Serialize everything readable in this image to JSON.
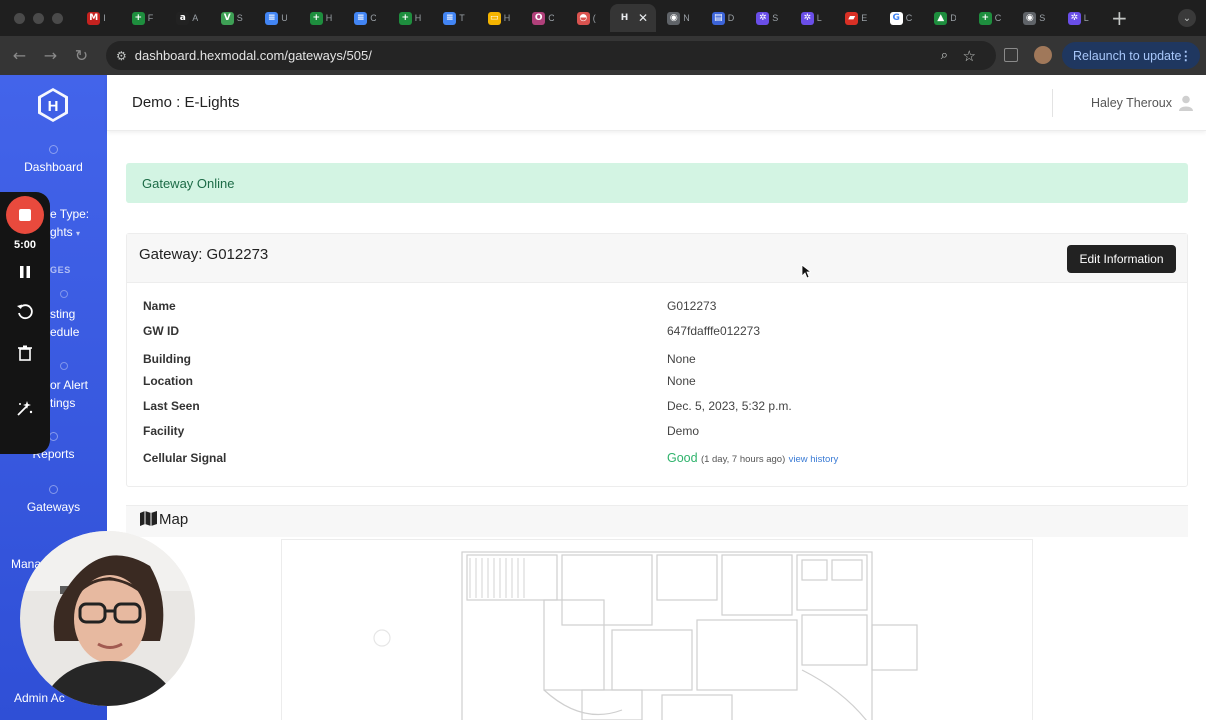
{
  "browser": {
    "tabs": [
      {
        "icon": "gmail-icon",
        "color": "#c5221f",
        "letter": "M",
        "label": "I"
      },
      {
        "icon": "sheets-icon",
        "color": "#1e8e3e",
        "letter": "+",
        "label": "F"
      },
      {
        "icon": "amazon-icon",
        "color": "#222222",
        "letter": "a",
        "label": "A"
      },
      {
        "icon": "v-brand-icon",
        "color": "#3ea055",
        "letter": "V",
        "label": "S"
      },
      {
        "icon": "docs-icon",
        "color": "#4285f4",
        "letter": "≡",
        "label": "U"
      },
      {
        "icon": "sheets-icon",
        "color": "#1e8e3e",
        "letter": "+",
        "label": "H"
      },
      {
        "icon": "docs-icon",
        "color": "#4285f4",
        "letter": "≡",
        "label": "C"
      },
      {
        "icon": "sheets-icon",
        "color": "#1e8e3e",
        "letter": "+",
        "label": "H"
      },
      {
        "icon": "docs-icon",
        "color": "#4285f4",
        "letter": "≡",
        "label": "T"
      },
      {
        "icon": "slides-icon",
        "color": "#f4b400",
        "letter": "▭",
        "label": "H"
      },
      {
        "icon": "circle-o-icon",
        "color": "#b0407a",
        "letter": "O",
        "label": "C"
      },
      {
        "icon": "cloud-icon",
        "color": "#d9534f",
        "letter": "◓",
        "label": "("
      },
      {
        "icon": "hexmodal-icon",
        "color": "#353535",
        "letter": "H",
        "label": "",
        "active": true
      },
      {
        "icon": "chrome-icon",
        "color": "#5f6368",
        "letter": "◉",
        "label": "N"
      },
      {
        "icon": "calendar-icon",
        "color": "#3c64d8",
        "letter": "▤",
        "label": "D"
      },
      {
        "icon": "gear-icon",
        "color": "#6a4ee8",
        "letter": "✲",
        "label": "S"
      },
      {
        "icon": "gear-icon",
        "color": "#6a4ee8",
        "letter": "✲",
        "label": "L"
      },
      {
        "icon": "flag-icon",
        "color": "#d93025",
        "letter": "▰",
        "label": "E"
      },
      {
        "icon": "google-icon",
        "color": "#ffffff",
        "letter": "G",
        "label": "C"
      },
      {
        "icon": "drive-icon",
        "color": "#1e8e3e",
        "letter": "▲",
        "label": "D"
      },
      {
        "icon": "sheets-icon",
        "color": "#1e8e3e",
        "letter": "+",
        "label": "C"
      },
      {
        "icon": "chrome-icon",
        "color": "#5f6368",
        "letter": "◉",
        "label": "S"
      },
      {
        "icon": "gear-icon",
        "color": "#6a4ee8",
        "letter": "✲",
        "label": "L"
      }
    ],
    "url": "dashboard.hexmodal.com/gateways/505/",
    "relaunch_label": "Relaunch to update"
  },
  "sidebar": {
    "dashboard": "Dashboard",
    "partial_type_line1": "e Type:",
    "partial_type_line2": "ghts",
    "pages_caption": "GES",
    "partial_schedule_line1": "sting",
    "partial_schedule_line2": "edule",
    "partial_alert_line1": "or Alert",
    "partial_alert_line2": "tings",
    "reports": "Reports",
    "gateways": "Gateways",
    "manage": "Mana",
    "admin": "Admin Ac"
  },
  "header": {
    "title": "Demo : E-Lights",
    "user": "Haley Theroux"
  },
  "status": {
    "message": "Gateway Online",
    "color": "#d3f4e3"
  },
  "gateway": {
    "title": "Gateway: G012273",
    "edit_label": "Edit Information",
    "fields": [
      {
        "label": "Name",
        "value": "G012273"
      },
      {
        "label": "GW ID",
        "value": "647fdafffe012273"
      },
      {
        "label": "Building",
        "value": "None"
      },
      {
        "label": "Location",
        "value": "None"
      },
      {
        "label": "Last Seen",
        "value": "Dec. 5, 2023, 5:32 p.m."
      },
      {
        "label": "Facility",
        "value": "Demo"
      }
    ],
    "signal": {
      "label": "Cellular Signal",
      "value": "Good",
      "note": "(1 day, 7 hours ago)",
      "link": "view history"
    }
  },
  "map": {
    "title": "Map"
  },
  "recording": {
    "timer": "5:00"
  }
}
